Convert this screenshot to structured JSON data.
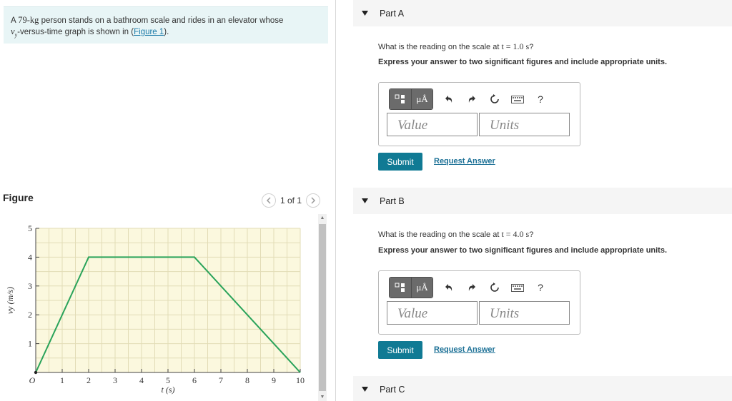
{
  "problem": {
    "text_pre": "A ",
    "mass": "79-kg",
    "text_mid": " person stands on a bathroom scale and rides in an elevator whose",
    "vy": "v",
    "vy_sub": "y",
    "text_after": "-versus-time graph is shown in (",
    "link": "Figure 1",
    "text_end": ")."
  },
  "figure": {
    "title": "Figure",
    "pager_text": "1 of 1",
    "prev_icon": "chevron-left-icon",
    "next_icon": "chevron-right-icon"
  },
  "chart_data": {
    "type": "line",
    "x": [
      0,
      2,
      6,
      10
    ],
    "series": [
      {
        "values": [
          0,
          4,
          4,
          0
        ],
        "color": "#2aa35a"
      }
    ],
    "xlabel": "t (s)",
    "ylabel": "vy (m/s)",
    "xlim": [
      0,
      10
    ],
    "ylim": [
      0,
      5
    ],
    "xticks": [
      "O",
      "1",
      "2",
      "3",
      "4",
      "5",
      "6",
      "7",
      "8",
      "9",
      "10"
    ],
    "yticks": [
      "1",
      "2",
      "3",
      "4",
      "5"
    ],
    "grid": true,
    "background": "#fbf8de"
  },
  "parts": [
    {
      "title": "Part A",
      "question_pre": "What is the reading on the scale at ",
      "question_math": "t = 1.0 s",
      "question_post": "?",
      "instruction": "Express your answer to two significant figures and include appropriate units.",
      "value_placeholder": "Value",
      "units_placeholder": "Units",
      "submit": "Submit",
      "request": "Request Answer"
    },
    {
      "title": "Part B",
      "question_pre": "What is the reading on the scale at ",
      "question_math": "t = 4.0 s",
      "question_post": "?",
      "instruction": "Express your answer to two significant figures and include appropriate units.",
      "value_placeholder": "Value",
      "units_placeholder": "Units",
      "submit": "Submit",
      "request": "Request Answer"
    },
    {
      "title": "Part C"
    }
  ],
  "toolbar": {
    "mu_label": "μÅ",
    "help_label": "?",
    "icons": [
      "templates-icon",
      "units-icon",
      "undo-icon",
      "redo-icon",
      "reset-icon",
      "keyboard-icon",
      "help-icon"
    ]
  },
  "colors": {
    "accent": "#107a94",
    "link": "#1a6f95",
    "problem_bg": "#e8f5f6",
    "line": "#2aa35a"
  }
}
